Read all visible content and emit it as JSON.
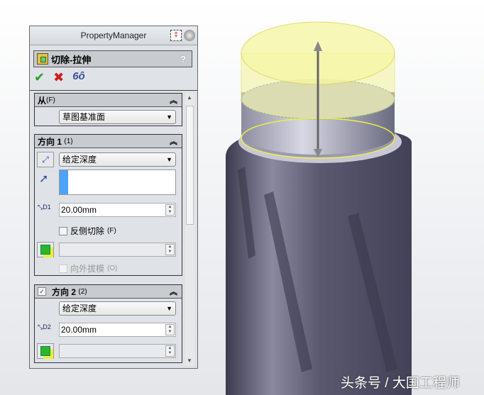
{
  "property_manager": {
    "title": "PropertyManager",
    "feature_name": "切除-拉伸",
    "help": "?",
    "actions": {
      "ok": "✔",
      "cancel": "✖",
      "preview": "6ô"
    },
    "from": {
      "label": "从",
      "hotkey": "(F)",
      "value": "草图基准面"
    },
    "direction1": {
      "label": "方向 1",
      "hotkey": "(1)",
      "end_condition": "给定深度",
      "depth": "20.00mm",
      "dim_label": "D1",
      "flip_side_label": "反侧切除",
      "flip_side_hotkey": "(F)",
      "flip_side_checked": false,
      "draft_outward_label": "向外拔模",
      "draft_outward_hotkey": "(O)"
    },
    "direction2": {
      "label": "方向 2",
      "hotkey": "(2)",
      "checked": true,
      "end_condition": "给定深度",
      "depth": "20.00mm",
      "dim_label": "D2"
    }
  },
  "watermark": "头条号 / 大国工程师",
  "colors": {
    "panel": "#dfe3e8",
    "model": "#5e5d72",
    "preview": "#f3f39a"
  }
}
